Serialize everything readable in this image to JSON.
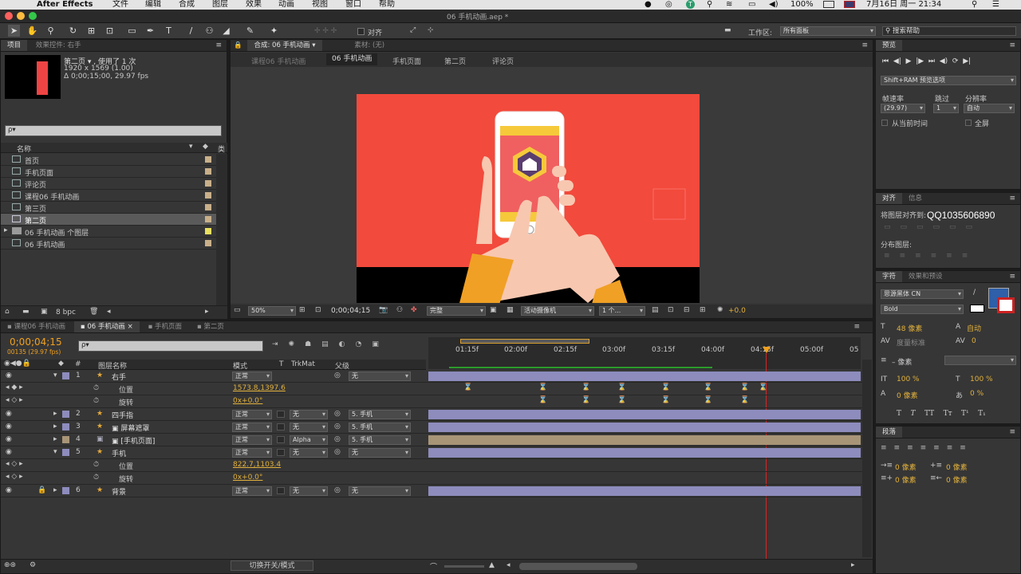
{
  "menubar": {
    "app": "After Effects",
    "menus": [
      "文件",
      "编辑",
      "合成",
      "图层",
      "效果",
      "动画",
      "视图",
      "窗口",
      "帮助"
    ],
    "battery": "100%",
    "datetime": "7月16日 周一  21:34"
  },
  "window": {
    "title": "06 手机动画.aep *"
  },
  "toolbar": {
    "snap_label": "对齐",
    "workspace_label": "工作区:",
    "workspace_value": "所有面板",
    "search_placeholder": "搜索帮助"
  },
  "project": {
    "tab_project": "项目",
    "tab_effects": "效果控件: 右手",
    "item_name": "第二页 ▾ , 使用了 1 次",
    "item_size": "1920 x 1569 (1.00)",
    "item_duration": "Δ 0;00;15;00, 29.97 fps",
    "search_placeholder": "ρ▾",
    "col_name": "名称",
    "items": [
      {
        "name": "首页",
        "type": "comp",
        "color": "#c9b08a"
      },
      {
        "name": "手机页面",
        "type": "comp",
        "color": "#c9b08a"
      },
      {
        "name": "评论页",
        "type": "comp",
        "color": "#c9b08a"
      },
      {
        "name": "课程06 手机动画",
        "type": "comp",
        "color": "#c9b08a"
      },
      {
        "name": "第三页",
        "type": "comp",
        "color": "#c9b08a"
      },
      {
        "name": "第二页",
        "type": "comp",
        "color": "#c9b08a"
      },
      {
        "name": "06 手机动画 个图层",
        "type": "folder",
        "color": "#e8e060"
      },
      {
        "name": "06 手机动画",
        "type": "comp",
        "color": "#c9b08a"
      }
    ],
    "bpc": "8 bpc"
  },
  "composition": {
    "tab_label": "合成: 06 手机动画",
    "footage_label": "素材: (无)",
    "breadcrumbs": [
      "课程06 手机动画",
      "06 手机动画",
      "手机页面",
      "第二页",
      "评论页"
    ],
    "zoom": "50%",
    "timecode": "0;00;04;15",
    "quality": "完整",
    "camera": "活动摄像机",
    "views": "1 个...",
    "exposure": "+0.0"
  },
  "preview": {
    "tab": "预览",
    "ram_options": "Shift+RAM 预览选项",
    "frame_rate_label": "帧速率",
    "skip_label": "跳过",
    "resolution_label": "分辨率",
    "frame_rate": "(29.97)",
    "skip": "1",
    "resolution": "自动",
    "from_current": "从当前时间",
    "fullscreen": "全屏"
  },
  "align": {
    "tab": "对齐",
    "tab2": "信息",
    "align_to": "将图层对齐到:",
    "distribute": "分布图层:",
    "watermark": "QQ1035606890"
  },
  "character": {
    "tab": "字符",
    "tab2": "效果和预设",
    "font": "思源黑体 CN",
    "style": "Bold",
    "size": "48 像素",
    "leading": "自动",
    "tracking_label": "度量标准",
    "tracking": "0",
    "stroke": "– 像素",
    "vscale": "100 %",
    "hscale": "100 %",
    "baseline": "0 像素",
    "tsume": "0 %",
    "fill_color": "#2e5fa8",
    "styles": [
      "T",
      "T",
      "TT",
      "Tт",
      "T¹",
      "T₁"
    ]
  },
  "paragraph": {
    "tab": "段落",
    "indent_values": [
      "0 像素",
      "0 像素",
      "0 像素",
      "0 像素",
      "0 像素"
    ]
  },
  "timeline": {
    "tabs": [
      "课程06 手机动画",
      "06 手机动画",
      "手机页面",
      "第二页"
    ],
    "timecode": "0;00;04;15",
    "frames": "00135 (29.97 fps)",
    "search_placeholder": "ρ▾",
    "columns": {
      "num": "#",
      "name": "图层名称",
      "mode": "模式",
      "t": "T",
      "trkmat": "TrkMat",
      "parent": "父级"
    },
    "ruler": [
      "01:15f",
      "02:00f",
      "02:15f",
      "03:00f",
      "03:15f",
      "04:00f",
      "04:15f",
      "05:00f",
      "05"
    ],
    "toggle_label": "切换开关/模式",
    "layers": [
      {
        "num": "1",
        "name": "右手",
        "mode": "正常",
        "trkmat": "",
        "parent": "无",
        "color": "#8d8cbd",
        "expanded": true,
        "kind": "shape"
      },
      {
        "prop": "位置",
        "value": "1573.8,1397.6"
      },
      {
        "prop": "旋转",
        "value": "0x+0.0°"
      },
      {
        "num": "2",
        "name": "四手指",
        "mode": "正常",
        "trkmat": "无",
        "parent": "5. 手机",
        "color": "#8d8cbd",
        "kind": "shape"
      },
      {
        "num": "3",
        "name": "屏幕遮罩",
        "mode": "正常",
        "trkmat": "无",
        "parent": "5. 手机",
        "color": "#8d8cbd",
        "kind": "shape"
      },
      {
        "num": "4",
        "name": "[手机页面]",
        "mode": "正常",
        "trkmat": "Alpha",
        "parent": "5. 手机",
        "color": "#a89577",
        "kind": "comp"
      },
      {
        "num": "5",
        "name": "手机",
        "mode": "正常",
        "trkmat": "无",
        "parent": "无",
        "color": "#8d8cbd",
        "expanded": true,
        "kind": "shape"
      },
      {
        "prop": "位置",
        "value": "822.7,1103.4"
      },
      {
        "prop": "旋转",
        "value": "0x+0.0°"
      },
      {
        "num": "6",
        "name": "背景",
        "mode": "正常",
        "trkmat": "无",
        "parent": "无",
        "color": "#8d8cbd",
        "kind": "shape"
      }
    ]
  }
}
